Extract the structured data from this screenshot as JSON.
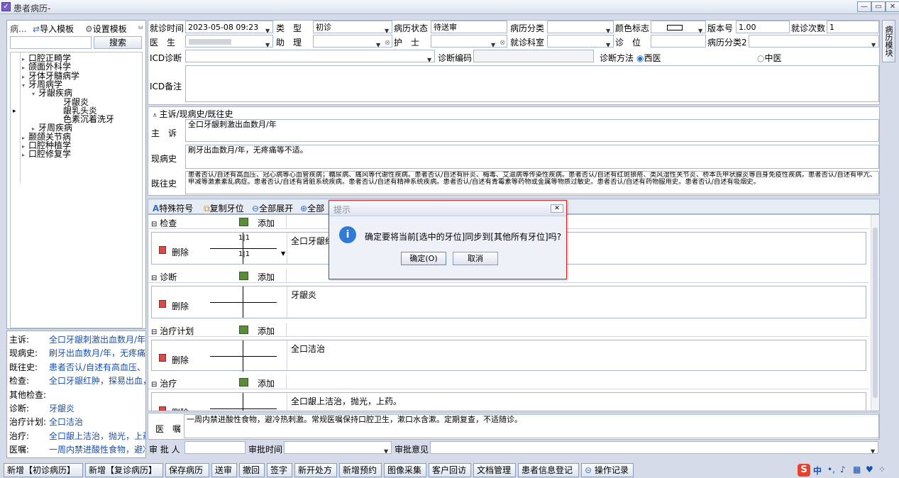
{
  "window": {
    "title": "患者病历-"
  },
  "left": {
    "header_label": "病...",
    "import_label": "导入模板",
    "settings_label": "设置模板",
    "search_label": "搜索",
    "tree": [
      {
        "label": "口腔正畸学",
        "level": 1
      },
      {
        "label": "颌面外科学",
        "level": 1
      },
      {
        "label": "牙体牙髓病学",
        "level": 1
      },
      {
        "label": "牙周病学",
        "level": 1
      },
      {
        "label": "牙龈疾病",
        "level": 2
      },
      {
        "label": "牙龈炎",
        "level": 3
      },
      {
        "label": "龈乳头炎",
        "level": 3
      },
      {
        "label": "色素沉着洗牙",
        "level": 3
      },
      {
        "label": "牙周疾病",
        "level": 2
      },
      {
        "label": "颞颌关节病",
        "level": 1
      },
      {
        "label": "口腔种植学",
        "level": 1
      },
      {
        "label": "口腔修复学",
        "level": 1
      }
    ],
    "summary": [
      {
        "label": "主诉:",
        "value": "全口牙龈刺激出血数月/年"
      },
      {
        "label": "现病史:",
        "value": "刷牙出血数月/年，无疼痛"
      },
      {
        "label": "既往史:",
        "value": "患者否认/自述有高血压、"
      },
      {
        "label": "检查:",
        "value": "全口牙龈红肿，探易出血，"
      },
      {
        "label": "其他检查:",
        "value": ""
      },
      {
        "label": "诊断:",
        "value": "牙龈炎"
      },
      {
        "label": "治疗计划:",
        "value": "全口洁治"
      },
      {
        "label": "治疗:",
        "value": "全口龈上洁治，抛光，上药"
      },
      {
        "label": "医嘱:",
        "value": "一周内禁进酸性食物，避冷"
      }
    ]
  },
  "form": {
    "visit_time_label": "就诊时间",
    "visit_time": "2023-05-08 09:23",
    "type_label": "类　型",
    "type_value": "初诊",
    "status_label": "病历状态",
    "status_value": "待送审",
    "category_label": "病历分类",
    "color_label": "颜色标志",
    "version_label": "版本号",
    "version_value": "1.00",
    "visit_count_label": "就诊次数",
    "visit_count": "1",
    "doctor_label": "医　生",
    "assistant_label": "助　理",
    "nurse_label": "护　士",
    "dept_label": "就诊科室",
    "position_label": "诊　位",
    "category2_label": "病历分类2",
    "icd_label": "ICD诊断",
    "icd_code_label": "诊断编码",
    "method_label": "诊断方法",
    "method_west": "西医",
    "method_chinese": "中医",
    "icd_note_label": "ICD备注",
    "side_tab": "病历模块"
  },
  "history": {
    "section_title": "主诉/现病史/既往史",
    "chief_label": "主　诉",
    "chief_value": "全口牙龈刺激出血数月/年",
    "present_label": "现病史",
    "present_value": "刷牙出血数月/年，无疼痛等不适。",
    "past_label": "既往史",
    "past_value": "患者否认/自述有高血压、冠心病等心血管疾病；糖尿病、痛风等代谢性疾病。患者否认/自述有肝炎、梅毒、艾滋病等传染性疾病。患者否认/自述有红斑狼疮、类风湿性关节炎、桥本氏甲状腺炎等自身免疫性疾病。患者否认/自述有甲亢、甲减等激素紊乱病症。患者否认/自述有肾脏系统疾病。患者否认/自述有精神系统疾病。患者否认/自述有青霉素等药物或金属等物质过敏史。患者否认/自述有药物服用史。患者否认/自述有吸烟史。"
  },
  "toolbar": {
    "special_char": "特殊符号",
    "copy_tooth": "复制牙位",
    "expand_all": "全部展开",
    "collapse_all": "全部"
  },
  "sections": [
    {
      "title": "检查",
      "add": "添加",
      "delete": "删除",
      "content": "全口牙龈红",
      "tooth_top": "1|1",
      "tooth_bottom": "1|1"
    },
    {
      "title": "诊断",
      "add": "添加",
      "delete": "删除",
      "content": "牙龈炎"
    },
    {
      "title": "治疗计划",
      "add": "添加",
      "delete": "删除",
      "content": "全口洁治"
    },
    {
      "title": "治疗",
      "add": "添加",
      "delete": "删除",
      "content": "全口龈上洁治，抛光，上药。"
    }
  ],
  "advice": {
    "label": "医　嘱",
    "value": "一周内禁进酸性食物，避冷热刺激。常规医嘱保持口腔卫生，漱口水含漱。定期复查，不适随诊。",
    "approver_label": "审 批 人",
    "approve_time_label": "审批时间",
    "approve_opinion_label": "审批意见"
  },
  "dialog": {
    "title": "提示",
    "message": "确定要将当前[选中的牙位]同步到[其他所有牙位]吗?",
    "ok": "确定(O)",
    "cancel": "取消"
  },
  "bottom_buttons": [
    "新增【初诊病历】",
    "新增【复诊病历】",
    "保存病历",
    "送审",
    "撤回",
    "签字",
    "新开处方",
    "新增预约",
    "图像采集",
    "客户回访",
    "文档管理",
    "患者信息登记",
    "操作记录"
  ],
  "tray": {
    "ime": "中"
  }
}
